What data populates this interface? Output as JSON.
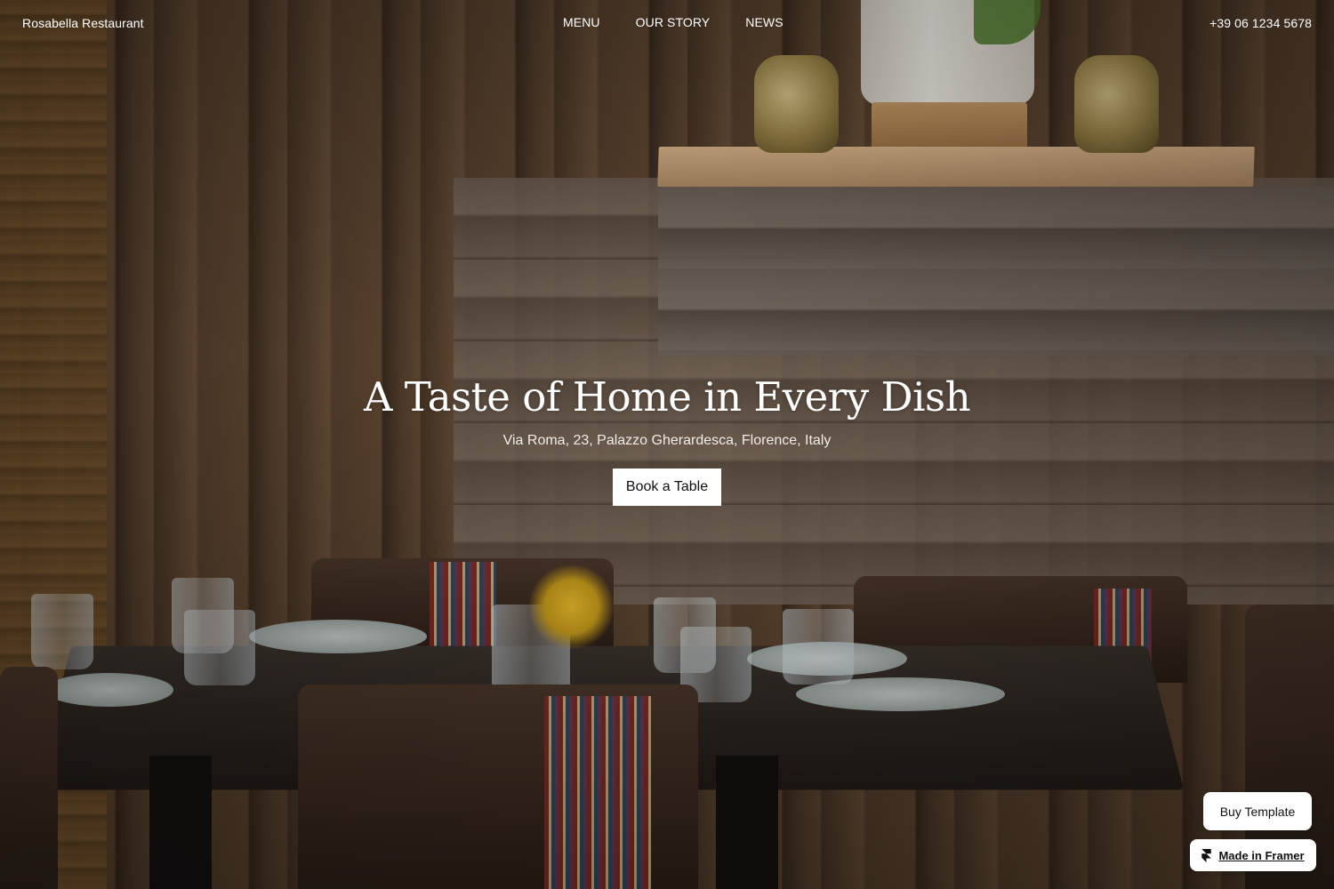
{
  "header": {
    "brand": "Rosabella Restaurant",
    "nav": [
      "MENU",
      "OUR STORY",
      "NEWS"
    ],
    "phone": "+39 06 1234 5678"
  },
  "hero": {
    "title": "A Taste of Home in Every Dish",
    "address": "Via Roma, 23, Palazzo Gherardesca, Florence, Italy",
    "cta_label": "Book a Table"
  },
  "badges": {
    "buy_template": "Buy Template",
    "made_in_framer": "Made in Framer",
    "framer_icon": "framer-logo-icon"
  },
  "colors": {
    "text": "#ffffff",
    "button_bg": "#ffffff",
    "button_text": "#111111"
  }
}
